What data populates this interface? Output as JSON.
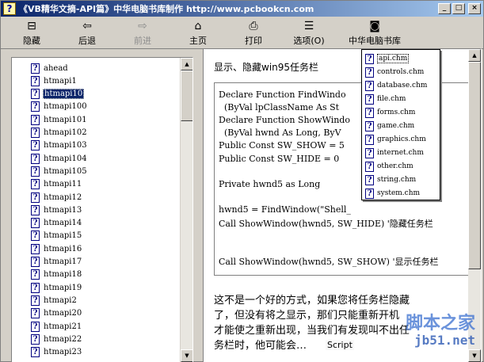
{
  "window": {
    "title": "《VB精华文摘-API篇》中华电脑书库制作 http://www.pcbookcn.com",
    "buttons": {
      "minimize": "_",
      "maximize": "□",
      "close": "×"
    }
  },
  "toolbar": {
    "items": [
      {
        "label": "隐藏",
        "icon": "hide-icon",
        "glyph": "⊟",
        "enabled": true
      },
      {
        "label": "后退",
        "icon": "back-arrow-icon",
        "glyph": "⇦",
        "enabled": true
      },
      {
        "label": "前进",
        "icon": "forward-arrow-icon",
        "glyph": "⇨",
        "enabled": false
      },
      {
        "label": "主页",
        "icon": "home-icon",
        "glyph": "⌂",
        "enabled": true
      },
      {
        "label": "打印",
        "icon": "printer-icon",
        "glyph": "⎙",
        "enabled": true
      },
      {
        "label": "选项(O)",
        "icon": "options-icon",
        "glyph": "☰",
        "enabled": true
      },
      {
        "label": "中华电脑书库",
        "icon": "book-icon",
        "glyph": "◙",
        "enabled": true
      }
    ]
  },
  "tree": {
    "items": [
      "ahead",
      "htmapi1",
      "htmapi10",
      "htmapi100",
      "htmapi101",
      "htmapi102",
      "htmapi103",
      "htmapi104",
      "htmapi105",
      "htmapi11",
      "htmapi12",
      "htmapi13",
      "htmapi14",
      "htmapi15",
      "htmapi16",
      "htmapi17",
      "htmapi18",
      "htmapi19",
      "htmapi2",
      "htmapi20",
      "htmapi21",
      "htmapi22",
      "htmapi23"
    ],
    "selected_index": 2
  },
  "content": {
    "heading": "显示、隐藏win95任务栏",
    "code_lines": [
      "Declare Function FindWindo",
      "  (ByVal lpClassName As St",
      "Declare Function ShowWindo",
      "  (ByVal hwnd As Long, ByV",
      "Public Const SW_SHOW = 5",
      "Public Const SW_HIDE = 0",
      "",
      "Private hwnd5 as Long",
      "",
      "hwnd5 = FindWindow(\"Shell_",
      "Call ShowWindow(hwnd5, SW_HIDE) '隐藏任务栏",
      "",
      "",
      "Call ShowWindow(hwnd5, SW_SHOW) '显示任务栏"
    ],
    "paragraph_lines": [
      "这不是一个好的方式，如果您将任务栏隐藏",
      "了，但没有将之显示，那们只能重新开机",
      "才能使之重新出现，当我们有发现叫不出任",
      "务栏时，他可能会…"
    ]
  },
  "dropdown": {
    "items": [
      "api.chm",
      "controls.chm",
      "database.chm",
      "file.chm",
      "forms.chm",
      "game.chm",
      "graphics.chm",
      "internet.chm",
      "other.chm",
      "string.chm",
      "system.chm"
    ],
    "selected_index": 0
  },
  "status": {
    "script_label": "Script"
  },
  "watermark": {
    "line1": "脚本之家",
    "line2": "jb51.net"
  }
}
